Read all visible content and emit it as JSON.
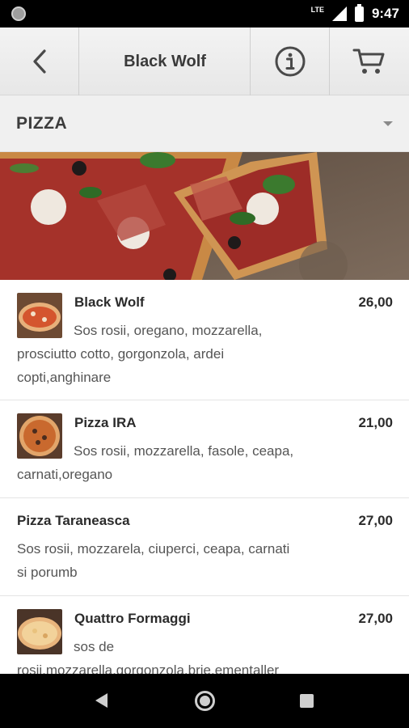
{
  "status_bar": {
    "network": "LTE",
    "time": "9:47"
  },
  "header": {
    "title": "Black Wolf",
    "back_icon": "chevron-left-icon",
    "info_icon": "info-icon",
    "cart_icon": "cart-icon"
  },
  "category": {
    "selected": "PIZZA",
    "caret_icon": "caret-down-icon"
  },
  "menu": {
    "items": [
      {
        "name": "Black Wolf",
        "price": "26,00",
        "desc_line1": "Sos rosii, oregano, mozzarella,",
        "desc_rest": [
          "prosciutto cotto, gorgonzola, ardei",
          "copti,anghinare"
        ]
      },
      {
        "name": "Pizza IRA",
        "price": "21,00",
        "desc_line1": "Sos rosii, mozzarella, fasole, ceapa,",
        "desc_rest": [
          "carnati,oregano"
        ]
      },
      {
        "name": "Pizza Taraneasca",
        "price": "27,00",
        "desc_line1": "Sos rosii, mozzarela, ciuperci, ceapa, carnati",
        "desc_rest": [
          "si porumb"
        ]
      },
      {
        "name": "Quattro Formaggi",
        "price": "27,00",
        "desc_line1": "sos de",
        "desc_rest": [
          "rosii,mozzarella,gorgonzola,brie,ementaller"
        ]
      }
    ]
  },
  "colors": {
    "header_bg": "#ececec",
    "category_bg": "#f0f0f0",
    "system_bar": "#000000"
  }
}
